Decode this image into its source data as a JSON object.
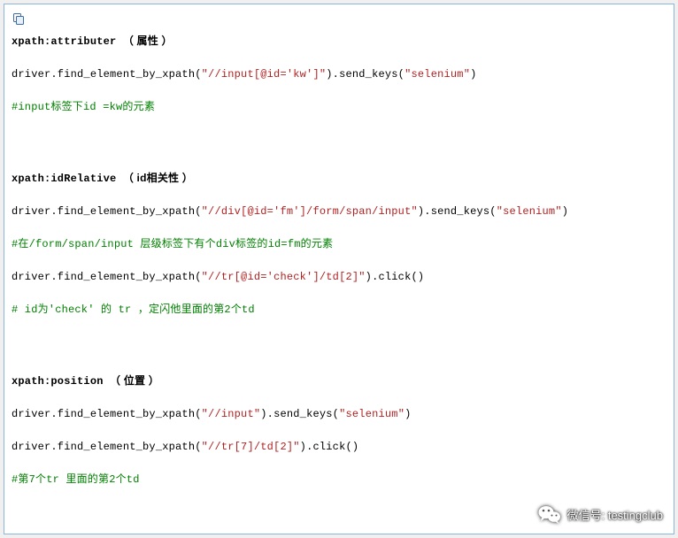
{
  "section1": {
    "header_pre": "xpath:attributer ",
    "header_paren": "（ 属性 ）",
    "code1_pre": "driver.find_element_by_xpath(",
    "code1_q1": "\"//input[@id='kw']\"",
    "code1_mid": ").send_keys(",
    "code1_q2": "\"selenium\"",
    "code1_end": ")",
    "comment1": "#input标签下id =kw的元素"
  },
  "section2": {
    "header_pre": "xpath:idRelative ",
    "header_paren": "（ id相关性 ）",
    "code1_pre": "driver.find_element_by_xpath(",
    "code1_q1": "\"//div[@id='fm']/form/span/input\"",
    "code1_mid": ").send_keys(",
    "code1_q2": "\"selenium\"",
    "code1_end": ")",
    "comment1": "#在/form/span/input 层级标签下有个div标签的id=fm的元素",
    "code2_pre": "driver.find_element_by_xpath(",
    "code2_q1": "\"//tr[@id='check']/td[2]\"",
    "code2_end": ").click()",
    "comment2": "# id为'check' 的 tr ，定闪他里面的第2个td"
  },
  "section3": {
    "header_pre": "xpath:position ",
    "header_paren": "（ 位置 ）",
    "code1_pre": "driver.find_element_by_xpath(",
    "code1_q1": "\"//input\"",
    "code1_mid": ").send_keys(",
    "code1_q2": "\"selenium\"",
    "code1_end": ")",
    "code2_pre": "driver.find_element_by_xpath(",
    "code2_q1": "\"//tr[7]/td[2]\"",
    "code2_end": ").click()",
    "comment1": "#第7个tr 里面的第2个td"
  },
  "watermark": {
    "label": "微信号: ",
    "id": "testingclub"
  }
}
